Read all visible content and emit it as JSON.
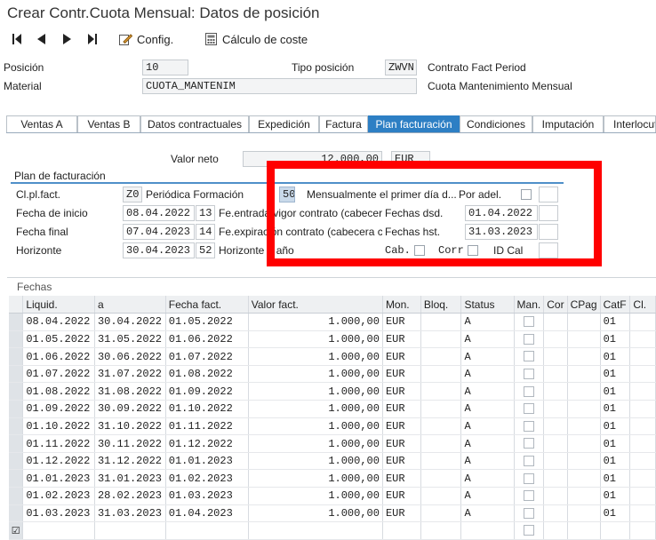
{
  "title": "Crear Contr.Cuota Mensual: Datos de posición",
  "toolbar": {
    "config": "Config.",
    "calculo": "Cálculo de coste"
  },
  "header": {
    "posicion_label": "Posición",
    "posicion_value": "10",
    "tipo_label": "Tipo posición",
    "tipo_value": "ZWVN",
    "tipo_desc": "Contrato Fact Period",
    "material_label": "Material",
    "material_value": "CUOTA_MANTENIM",
    "material_desc": "Cuota Mantenimiento Mensual"
  },
  "tabs": [
    "Ventas A",
    "Ventas B",
    "Datos contractuales",
    "Expedición",
    "Factura",
    "Plan facturación",
    "Condiciones",
    "Imputación",
    "Interlocut"
  ],
  "valor": {
    "label": "Valor neto",
    "value": "12.000,00",
    "currency": "EUR"
  },
  "plan": {
    "title": "Plan de facturación",
    "cl_label": "Cl.pl.fact.",
    "cl_value": "Z0",
    "cl_desc": "Periódica Formación",
    "r1_value": "50",
    "r1_desc": "Mensualmente el primer día d...",
    "por_adel": "Por adel.",
    "inicio_label": "Fecha de inicio",
    "inicio_value": "08.04.2022",
    "inicio_code": "13",
    "inicio_desc": "Fe.entrada vigor contrato (cabecer...",
    "dsd_label": "Fechas dsd.",
    "dsd_value": "01.04.2022",
    "final_label": "Fecha final",
    "final_value": "07.04.2023",
    "final_code": "14",
    "final_desc": "Fe.expiración contrato (cabecera co...",
    "hst_label": "Fechas hst.",
    "hst_value": "31.03.2023",
    "hor_label": "Horizonte",
    "hor_value": "30.04.2023",
    "hor_code": "52",
    "hor_desc": "Horizonte 1 año",
    "cab": "Cab.",
    "corr": "Corr",
    "idcal": "ID Cal"
  },
  "fechas": {
    "title": "Fechas",
    "columns": [
      "Liquid.",
      "a",
      "Fecha fact.",
      "Valor fact.",
      "Mon.",
      "Bloq.",
      "Status",
      "Man.",
      "Cor",
      "CPag",
      "CatF",
      "Cl."
    ],
    "rows": [
      [
        "08.04.2022",
        "30.04.2022",
        "01.05.2022",
        "1.000,00",
        "EUR",
        "",
        "A",
        "",
        "",
        "",
        "01"
      ],
      [
        "01.05.2022",
        "31.05.2022",
        "01.06.2022",
        "1.000,00",
        "EUR",
        "",
        "A",
        "",
        "",
        "",
        "01"
      ],
      [
        "01.06.2022",
        "30.06.2022",
        "01.07.2022",
        "1.000,00",
        "EUR",
        "",
        "A",
        "",
        "",
        "",
        "01"
      ],
      [
        "01.07.2022",
        "31.07.2022",
        "01.08.2022",
        "1.000,00",
        "EUR",
        "",
        "A",
        "",
        "",
        "",
        "01"
      ],
      [
        "01.08.2022",
        "31.08.2022",
        "01.09.2022",
        "1.000,00",
        "EUR",
        "",
        "A",
        "",
        "",
        "",
        "01"
      ],
      [
        "01.09.2022",
        "30.09.2022",
        "01.10.2022",
        "1.000,00",
        "EUR",
        "",
        "A",
        "",
        "",
        "",
        "01"
      ],
      [
        "01.10.2022",
        "31.10.2022",
        "01.11.2022",
        "1.000,00",
        "EUR",
        "",
        "A",
        "",
        "",
        "",
        "01"
      ],
      [
        "01.11.2022",
        "30.11.2022",
        "01.12.2022",
        "1.000,00",
        "EUR",
        "",
        "A",
        "",
        "",
        "",
        "01"
      ],
      [
        "01.12.2022",
        "31.12.2022",
        "01.01.2023",
        "1.000,00",
        "EUR",
        "",
        "A",
        "",
        "",
        "",
        "01"
      ],
      [
        "01.01.2023",
        "31.01.2023",
        "01.02.2023",
        "1.000,00",
        "EUR",
        "",
        "A",
        "",
        "",
        "",
        "01"
      ],
      [
        "01.02.2023",
        "28.02.2023",
        "01.03.2023",
        "1.000,00",
        "EUR",
        "",
        "A",
        "",
        "",
        "",
        "01"
      ],
      [
        "01.03.2023",
        "31.03.2023",
        "01.04.2023",
        "1.000,00",
        "EUR",
        "",
        "A",
        "",
        "",
        "",
        "01"
      ]
    ]
  },
  "colors": {
    "accent": "#2d7fc4",
    "highlight": "#ff0000"
  }
}
